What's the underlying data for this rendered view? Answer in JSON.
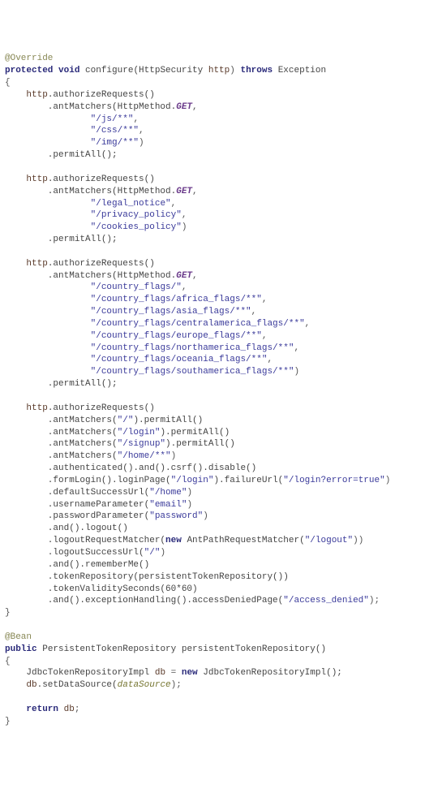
{
  "code": {
    "lines": [
      [
        {
          "t": "@Override",
          "c": "ann"
        }
      ],
      [
        {
          "t": "protected",
          "c": "kw"
        },
        {
          "t": " void ",
          "c": "kw"
        },
        {
          "t": "configure(HttpSecurity ",
          "c": "type"
        },
        {
          "t": "http",
          "c": "var"
        },
        {
          "t": ") ",
          "c": "op"
        },
        {
          "t": "throws ",
          "c": "kw"
        },
        {
          "t": "Exception",
          "c": "type"
        }
      ],
      [
        {
          "t": "{",
          "c": "op"
        }
      ],
      [
        {
          "t": "    http",
          "c": "var"
        },
        {
          "t": ".authorizeRequests()",
          "c": "fn"
        }
      ],
      [
        {
          "t": "        .antMatchers(HttpMethod.",
          "c": "fn"
        },
        {
          "t": "GET",
          "c": "const"
        },
        {
          "t": ",",
          "c": "op"
        }
      ],
      [
        {
          "t": "                ",
          "c": "op"
        },
        {
          "t": "\"/js/**\"",
          "c": "str"
        },
        {
          "t": ",",
          "c": "op"
        }
      ],
      [
        {
          "t": "                ",
          "c": "op"
        },
        {
          "t": "\"/css/**\"",
          "c": "str"
        },
        {
          "t": ",",
          "c": "op"
        }
      ],
      [
        {
          "t": "                ",
          "c": "op"
        },
        {
          "t": "\"/img/**\"",
          "c": "str"
        },
        {
          "t": ")",
          "c": "op"
        }
      ],
      [
        {
          "t": "        .permitAll();",
          "c": "fn"
        }
      ],
      [
        {
          "t": "",
          "c": "op"
        }
      ],
      [
        {
          "t": "    http",
          "c": "var"
        },
        {
          "t": ".authorizeRequests()",
          "c": "fn"
        }
      ],
      [
        {
          "t": "        .antMatchers(HttpMethod.",
          "c": "fn"
        },
        {
          "t": "GET",
          "c": "const"
        },
        {
          "t": ",",
          "c": "op"
        }
      ],
      [
        {
          "t": "                ",
          "c": "op"
        },
        {
          "t": "\"/legal_notice\"",
          "c": "str"
        },
        {
          "t": ",",
          "c": "op"
        }
      ],
      [
        {
          "t": "                ",
          "c": "op"
        },
        {
          "t": "\"/privacy_policy\"",
          "c": "str"
        },
        {
          "t": ",",
          "c": "op"
        }
      ],
      [
        {
          "t": "                ",
          "c": "op"
        },
        {
          "t": "\"/cookies_policy\"",
          "c": "str"
        },
        {
          "t": ")",
          "c": "op"
        }
      ],
      [
        {
          "t": "        .permitAll();",
          "c": "fn"
        }
      ],
      [
        {
          "t": "",
          "c": "op"
        }
      ],
      [
        {
          "t": "    http",
          "c": "var"
        },
        {
          "t": ".authorizeRequests()",
          "c": "fn"
        }
      ],
      [
        {
          "t": "        .antMatchers(HttpMethod.",
          "c": "fn"
        },
        {
          "t": "GET",
          "c": "const"
        },
        {
          "t": ",",
          "c": "op"
        }
      ],
      [
        {
          "t": "                ",
          "c": "op"
        },
        {
          "t": "\"/country_flags/\"",
          "c": "str"
        },
        {
          "t": ",",
          "c": "op"
        }
      ],
      [
        {
          "t": "                ",
          "c": "op"
        },
        {
          "t": "\"/country_flags/africa_flags/**\"",
          "c": "str"
        },
        {
          "t": ",",
          "c": "op"
        }
      ],
      [
        {
          "t": "                ",
          "c": "op"
        },
        {
          "t": "\"/country_flags/asia_flags/**\"",
          "c": "str"
        },
        {
          "t": ",",
          "c": "op"
        }
      ],
      [
        {
          "t": "                ",
          "c": "op"
        },
        {
          "t": "\"/country_flags/centralamerica_flags/**\"",
          "c": "str"
        },
        {
          "t": ",",
          "c": "op"
        }
      ],
      [
        {
          "t": "                ",
          "c": "op"
        },
        {
          "t": "\"/country_flags/europe_flags/**\"",
          "c": "str"
        },
        {
          "t": ",",
          "c": "op"
        }
      ],
      [
        {
          "t": "                ",
          "c": "op"
        },
        {
          "t": "\"/country_flags/northamerica_flags/**\"",
          "c": "str"
        },
        {
          "t": ",",
          "c": "op"
        }
      ],
      [
        {
          "t": "                ",
          "c": "op"
        },
        {
          "t": "\"/country_flags/oceania_flags/**\"",
          "c": "str"
        },
        {
          "t": ",",
          "c": "op"
        }
      ],
      [
        {
          "t": "                ",
          "c": "op"
        },
        {
          "t": "\"/country_flags/southamerica_flags/**\"",
          "c": "str"
        },
        {
          "t": ")",
          "c": "op"
        }
      ],
      [
        {
          "t": "        .permitAll();",
          "c": "fn"
        }
      ],
      [
        {
          "t": "",
          "c": "op"
        }
      ],
      [
        {
          "t": "    http",
          "c": "var"
        },
        {
          "t": ".authorizeRequests()",
          "c": "fn"
        }
      ],
      [
        {
          "t": "        .antMatchers(",
          "c": "fn"
        },
        {
          "t": "\"/\"",
          "c": "str"
        },
        {
          "t": ").permitAll()",
          "c": "fn"
        }
      ],
      [
        {
          "t": "        .antMatchers(",
          "c": "fn"
        },
        {
          "t": "\"/login\"",
          "c": "str"
        },
        {
          "t": ").permitAll()",
          "c": "fn"
        }
      ],
      [
        {
          "t": "        .antMatchers(",
          "c": "fn"
        },
        {
          "t": "\"/signup\"",
          "c": "str"
        },
        {
          "t": ").permitAll()",
          "c": "fn"
        }
      ],
      [
        {
          "t": "        .antMatchers(",
          "c": "fn"
        },
        {
          "t": "\"/home/**\"",
          "c": "str"
        },
        {
          "t": ")",
          "c": "op"
        }
      ],
      [
        {
          "t": "        .authenticated().and().csrf().disable()",
          "c": "fn"
        }
      ],
      [
        {
          "t": "        .formLogin().loginPage(",
          "c": "fn"
        },
        {
          "t": "\"/login\"",
          "c": "str"
        },
        {
          "t": ").failureUrl(",
          "c": "fn"
        },
        {
          "t": "\"/login?error=true\"",
          "c": "str"
        },
        {
          "t": ")",
          "c": "op"
        }
      ],
      [
        {
          "t": "        .defaultSuccessUrl(",
          "c": "fn"
        },
        {
          "t": "\"/home\"",
          "c": "str"
        },
        {
          "t": ")",
          "c": "op"
        }
      ],
      [
        {
          "t": "        .usernameParameter(",
          "c": "fn"
        },
        {
          "t": "\"email\"",
          "c": "str"
        },
        {
          "t": ")",
          "c": "op"
        }
      ],
      [
        {
          "t": "        .passwordParameter(",
          "c": "fn"
        },
        {
          "t": "\"password\"",
          "c": "str"
        },
        {
          "t": ")",
          "c": "op"
        }
      ],
      [
        {
          "t": "        .and().logout()",
          "c": "fn"
        }
      ],
      [
        {
          "t": "        .logoutRequestMatcher(",
          "c": "fn"
        },
        {
          "t": "new ",
          "c": "kw"
        },
        {
          "t": "AntPathRequestMatcher(",
          "c": "type"
        },
        {
          "t": "\"/logout\"",
          "c": "str"
        },
        {
          "t": "))",
          "c": "op"
        }
      ],
      [
        {
          "t": "        .logoutSuccessUrl(",
          "c": "fn"
        },
        {
          "t": "\"/\"",
          "c": "str"
        },
        {
          "t": ")",
          "c": "op"
        }
      ],
      [
        {
          "t": "        .and().rememberMe()",
          "c": "fn"
        }
      ],
      [
        {
          "t": "        .tokenRepository(persistentTokenRepository())",
          "c": "fn"
        }
      ],
      [
        {
          "t": "        .tokenValiditySeconds(60*60)",
          "c": "fn"
        }
      ],
      [
        {
          "t": "        .and().exceptionHandling().accessDeniedPage(",
          "c": "fn"
        },
        {
          "t": "\"/access_denied\"",
          "c": "str"
        },
        {
          "t": ");",
          "c": "op"
        }
      ],
      [
        {
          "t": "}",
          "c": "op"
        }
      ],
      [
        {
          "t": "",
          "c": "op"
        }
      ],
      [
        {
          "t": "@Bean",
          "c": "ann"
        }
      ],
      [
        {
          "t": "public ",
          "c": "kw"
        },
        {
          "t": "PersistentTokenRepository persistentTokenRepository()",
          "c": "type"
        }
      ],
      [
        {
          "t": "{",
          "c": "op"
        }
      ],
      [
        {
          "t": "    JdbcTokenRepositoryImpl ",
          "c": "type"
        },
        {
          "t": "db",
          "c": "var"
        },
        {
          "t": " = ",
          "c": "op"
        },
        {
          "t": "new ",
          "c": "kw"
        },
        {
          "t": "JdbcTokenRepositoryImpl();",
          "c": "type"
        }
      ],
      [
        {
          "t": "    db",
          "c": "var"
        },
        {
          "t": ".setDataSource(",
          "c": "fn"
        },
        {
          "t": "dataSource",
          "c": "field"
        },
        {
          "t": ");",
          "c": "op"
        }
      ],
      [
        {
          "t": "",
          "c": "op"
        }
      ],
      [
        {
          "t": "    ",
          "c": "op"
        },
        {
          "t": "return ",
          "c": "kw"
        },
        {
          "t": "db",
          "c": "var"
        },
        {
          "t": ";",
          "c": "op"
        }
      ],
      [
        {
          "t": "}",
          "c": "op"
        }
      ]
    ]
  }
}
